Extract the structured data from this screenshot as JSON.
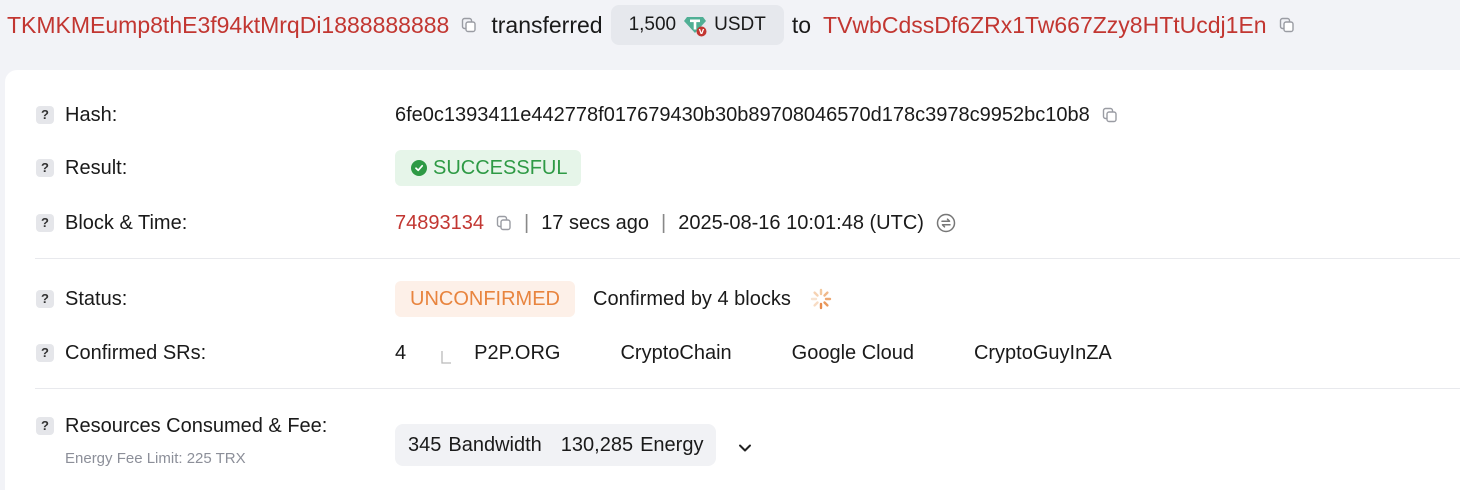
{
  "headline": {
    "from_address": "TKMKMEump8thE3f94ktMrqDi1888888888",
    "verb": "transferred",
    "amount": "1,500",
    "token": "USDT",
    "preposition": "to",
    "to_address": "TVwbCdssDf6ZRx1Tw667Zzy8HTtUcdj1En"
  },
  "details": {
    "hash_label": "Hash:",
    "hash_value": "6fe0c1393411e442778f017679430b30b89708046570d178c3978c9952bc10b8",
    "result_label": "Result:",
    "result_value": "SUCCESSFUL",
    "block_label": "Block & Time:",
    "block_number": "74893134",
    "age": "17 secs ago",
    "timestamp": "2025-08-16 10:01:48 (UTC)",
    "separator": "|",
    "status_label": "Status:",
    "status_value": "UNCONFIRMED",
    "confirmed_by": "Confirmed by 4 blocks",
    "srs_label": "Confirmed SRs:",
    "srs_count": "4",
    "srs": [
      "P2P.ORG",
      "CryptoChain",
      "Google Cloud",
      "CryptoGuyInZA"
    ],
    "resources_label": "Resources Consumed & Fee:",
    "fee_limit": "Energy Fee Limit: 225 TRX",
    "bandwidth_value": "345",
    "bandwidth_unit": "Bandwidth",
    "energy_value": "130,285",
    "energy_unit": "Energy",
    "help_glyph": "?"
  },
  "colors": {
    "link": "#c23631",
    "success": "#2e9a45",
    "unconfirmed": "#e8843e",
    "token_green": "#50af95"
  }
}
